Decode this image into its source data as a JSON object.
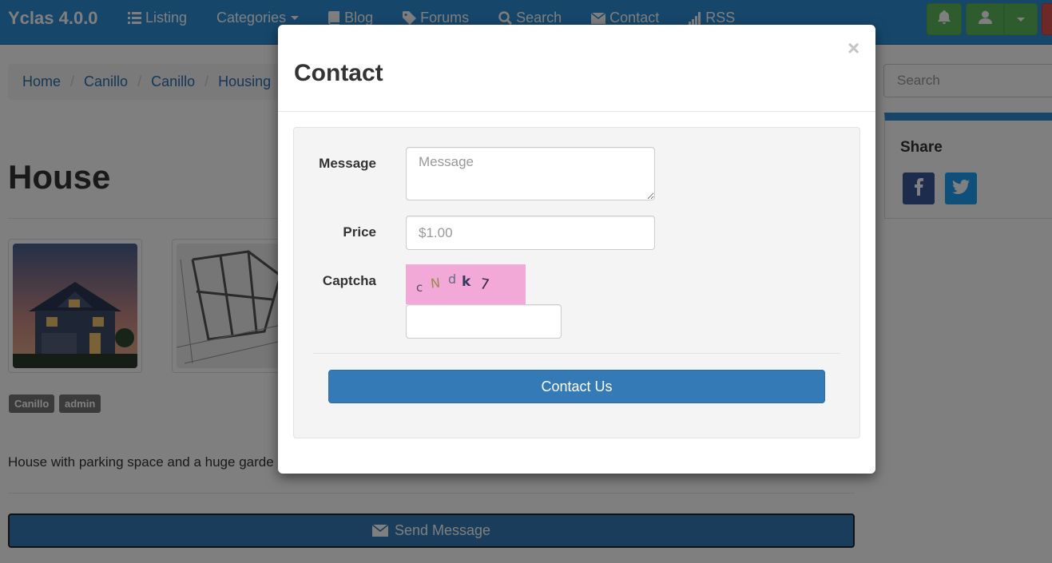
{
  "navbar": {
    "brand": "Yclas 4.0.0",
    "items": [
      {
        "label": "Listing",
        "icon": "list-icon"
      },
      {
        "label": "Categories",
        "icon": "none"
      },
      {
        "label": "Blog",
        "icon": "book-icon"
      },
      {
        "label": "Forums",
        "icon": "tag-icon"
      },
      {
        "label": "Search",
        "icon": "search-icon"
      },
      {
        "label": "Contact",
        "icon": "envelope-icon"
      },
      {
        "label": "RSS",
        "icon": "signal-icon"
      }
    ],
    "colors": {
      "bar": "#2c8ed6",
      "success": "#5cb85c",
      "danger": "#d9534f"
    }
  },
  "breadcrumb": [
    "Home",
    "Canillo",
    "Canillo",
    "Housing"
  ],
  "listing": {
    "title": "House",
    "tags": [
      "Canillo",
      "admin"
    ],
    "description": "House with parking space and a huge garde",
    "send_button": "Send Message"
  },
  "sidebar": {
    "search_placeholder": "Search",
    "share_title": "Share",
    "share_icons": [
      "facebook-icon",
      "twitter-icon"
    ]
  },
  "modal": {
    "title": "Contact",
    "close": "×",
    "form": {
      "message_label": "Message",
      "message_placeholder": "Message",
      "price_label": "Price",
      "price_placeholder": "$1.00",
      "captcha_label": "Captcha",
      "captcha_chars": [
        "c",
        "N",
        "d",
        "k",
        "7"
      ],
      "captcha_value": ""
    },
    "submit_button": "Contact Us",
    "colors": {
      "primary": "#337ab7",
      "captcha_bg": "#f3a9d8"
    }
  }
}
